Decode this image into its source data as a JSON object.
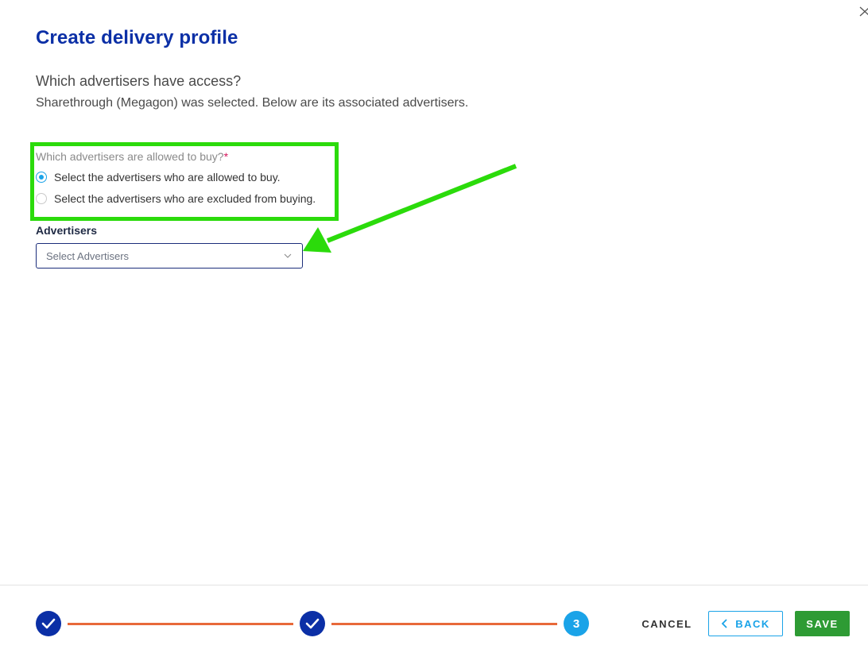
{
  "dialog": {
    "title": "Create delivery profile",
    "question": "Which advertisers have access?",
    "subtext": "Sharethrough (Megagon) was selected. Below are its associated advertisers."
  },
  "access_mode": {
    "label": "Which advertisers are allowed to buy?",
    "required_marker": "*",
    "options": [
      {
        "label": "Select the advertisers who are allowed to buy.",
        "selected": true
      },
      {
        "label": "Select the advertisers who are excluded from buying.",
        "selected": false
      }
    ]
  },
  "advertisers": {
    "label": "Advertisers",
    "placeholder": "Select Advertisers"
  },
  "stepper": {
    "steps": [
      {
        "state": "done",
        "label": ""
      },
      {
        "state": "done",
        "label": ""
      },
      {
        "state": "active",
        "label": "3"
      }
    ]
  },
  "footer": {
    "cancel_label": "CANCEL",
    "back_label": "BACK",
    "save_label": "SAVE"
  },
  "colors": {
    "title": "#0b2fa6",
    "accent": "#1aa3e8",
    "step_done": "#0b2fa6",
    "step_line": "#e8693a",
    "save": "#2e9b34",
    "annotation": "#2bdb0b"
  },
  "annotations": {
    "highlight_box": true,
    "arrow": true
  }
}
